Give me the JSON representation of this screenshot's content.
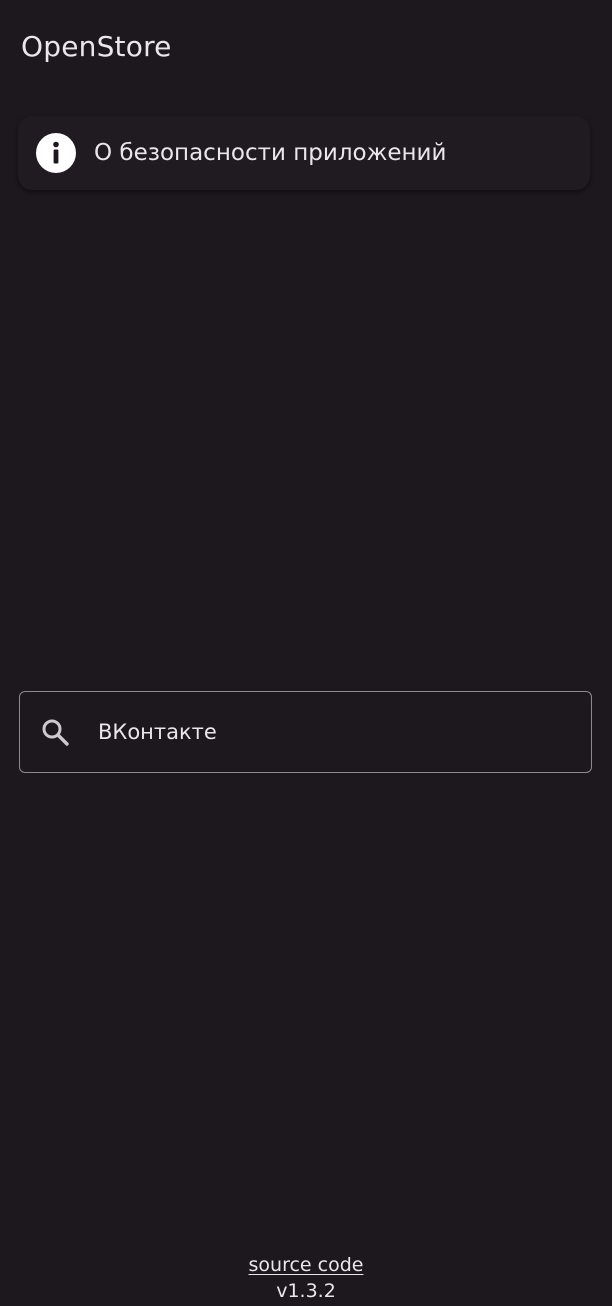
{
  "app": {
    "title": "OpenStore"
  },
  "info_card": {
    "label": "О безопасности приложений",
    "icon": "info-icon"
  },
  "search": {
    "value": "ВКонтакте",
    "icon": "search-icon"
  },
  "footer": {
    "source_code_label": "source code",
    "version": "v1.3.2"
  },
  "colors": {
    "background": "#1c181d",
    "text": "#ece6ec",
    "outline": "#8e8890"
  }
}
